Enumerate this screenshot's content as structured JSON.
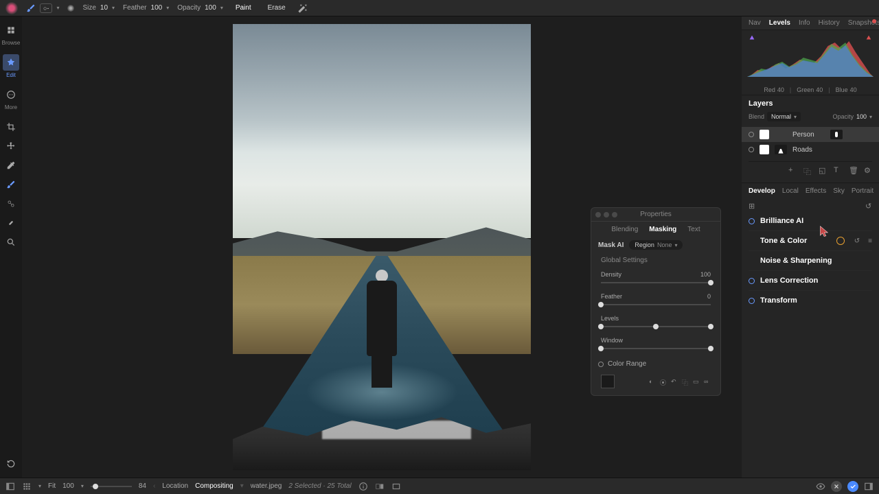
{
  "toolbar": {
    "size_label": "Size",
    "size_value": "10",
    "feather_label": "Feather",
    "feather_value": "100",
    "opacity_label": "Opacity",
    "opacity_value": "100",
    "paint": "Paint",
    "erase": "Erase"
  },
  "left_tools": {
    "browse": "Browse",
    "edit": "Edit",
    "more": "More"
  },
  "properties": {
    "title": "Properties",
    "tabs": {
      "blending": "Blending",
      "masking": "Masking",
      "text": "Text"
    },
    "mask_ai": "Mask AI",
    "region_label": "Region",
    "region_value": "None",
    "global_settings": "Global Settings",
    "density_label": "Density",
    "density_value": "100",
    "feather_label": "Feather",
    "feather_value": "0",
    "levels_label": "Levels",
    "window_label": "Window",
    "color_range": "Color Range"
  },
  "right_tabs": {
    "nav": "Nav",
    "levels": "Levels",
    "info": "Info",
    "history": "History",
    "snapshots": "Snapshots"
  },
  "histogram": {
    "red": "Red",
    "red_v": "40",
    "green": "Green",
    "green_v": "40",
    "blue": "Blue",
    "blue_v": "40"
  },
  "layers": {
    "title": "Layers",
    "blend_label": "Blend",
    "blend_value": "Normal",
    "opacity_label": "Opacity",
    "opacity_value": "100",
    "items": [
      {
        "name": "Person"
      },
      {
        "name": "Roads"
      }
    ]
  },
  "develop_tabs": {
    "develop": "Develop",
    "local": "Local",
    "effects": "Effects",
    "sky": "Sky",
    "portrait": "Portrait"
  },
  "adjustments": {
    "brilliance": "Brilliance AI",
    "tone_color": "Tone & Color",
    "noise": "Noise & Sharpening",
    "lens": "Lens Correction",
    "transform": "Transform"
  },
  "bottom": {
    "fit": "Fit",
    "zoom": "100",
    "zoom_display": "84",
    "location_label": "Location",
    "location_value": "Compositing",
    "filename": "water.jpeg",
    "selection": "2 Selected · 25 Total"
  }
}
